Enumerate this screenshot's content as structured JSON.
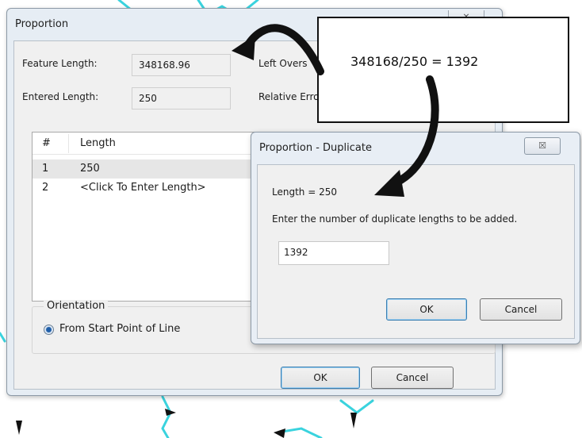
{
  "main_window": {
    "title": "Proportion",
    "close_glyph": "⨯",
    "feature_length_label": "Feature Length:",
    "feature_length_value": "348168.96",
    "entered_length_label": "Entered Length:",
    "entered_length_value": "250",
    "left_over_label": "Left Overs",
    "relative_error_label": "Relative Erro",
    "list": {
      "columns": [
        "#",
        "Length"
      ],
      "rows": [
        {
          "num": "1",
          "length": "250"
        },
        {
          "num": "2",
          "length": "<Click To Enter Length>"
        }
      ]
    },
    "orientation_label": "Orientation",
    "radio_from_start": "From Start Point of Line",
    "ok_label": "OK",
    "cancel_label": "Cancel"
  },
  "dup_dialog": {
    "title": "Proportion - Duplicate",
    "close_glyph": "☒",
    "length_text": "Length = 250",
    "prompt": "Enter the number of duplicate lengths to be added.",
    "input_value": "1392",
    "ok_label": "OK",
    "cancel_label": "Cancel"
  },
  "annotation": {
    "text": "348168/250 = 1392"
  },
  "colors": {
    "map_line": "#3ad3de",
    "accent": "#1f5ea8"
  }
}
